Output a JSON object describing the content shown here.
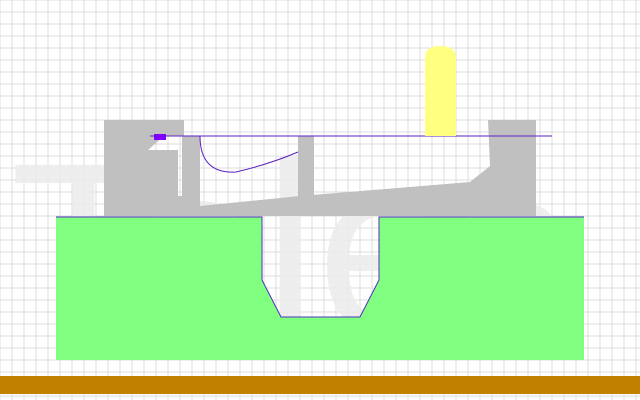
{
  "app": {
    "watermark_text": "Tales"
  },
  "colors": {
    "background": "#ffffff",
    "grid": "#dcdcdc",
    "terrain": "#80ff80",
    "terrain_outline": "#5030c0",
    "structure": "#c0c0c0",
    "ledge_line": "#5a20c0",
    "purple_item": "#8000ff",
    "player": "#ffff80",
    "floor": "#c08000",
    "watermark": "#ececec"
  },
  "icons": {
    "player": "capsule-character",
    "item": "purple-gem"
  }
}
